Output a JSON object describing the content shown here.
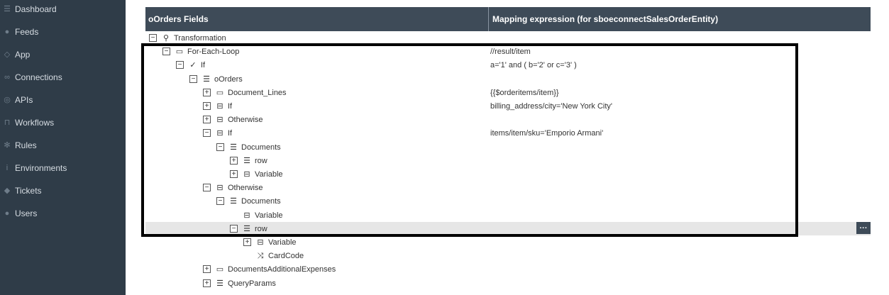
{
  "sidebar": {
    "items": [
      {
        "label": "Dashboard",
        "icon": "database-icon"
      },
      {
        "label": "Feeds",
        "icon": "comments-icon"
      },
      {
        "label": "App",
        "icon": "tag-icon"
      },
      {
        "label": "Connections",
        "icon": "link-icon"
      },
      {
        "label": "APIs",
        "icon": "globe-icon"
      },
      {
        "label": "Workflows",
        "icon": "workflow-icon"
      },
      {
        "label": "Rules",
        "icon": "gear-icon"
      },
      {
        "label": "Environments",
        "icon": "info-icon"
      },
      {
        "label": "Tickets",
        "icon": "ticket-icon"
      },
      {
        "label": "Users",
        "icon": "user-icon"
      }
    ]
  },
  "grid": {
    "header": {
      "fields": "oOrders Fields",
      "mapping": "Mapping expression (for sboeconnectSalesOrderEntity)"
    },
    "rows": [
      {
        "label": "Transformation",
        "expr": "",
        "toggle": "−",
        "icon": "pin-icon"
      },
      {
        "label": "For-Each-Loop",
        "expr": "//result/item",
        "toggle": "−",
        "icon": "loop-icon"
      },
      {
        "label": "If",
        "expr": "a='1' and ( b='2' or c='3' )",
        "toggle": "−",
        "icon": "check-circle-icon"
      },
      {
        "label": "oOrders",
        "expr": "",
        "toggle": "−",
        "icon": "table-icon"
      },
      {
        "label": "Document_Lines",
        "expr": "{{$orderitems/item}}",
        "toggle": "+",
        "icon": "loop-icon"
      },
      {
        "label": "If",
        "expr": "billing_address/city='New York City'",
        "toggle": "+",
        "icon": "drive-icon"
      },
      {
        "label": "Otherwise",
        "expr": "",
        "toggle": "+",
        "icon": "drive-icon"
      },
      {
        "label": "If",
        "expr": "items/item/sku='Emporio Armani'",
        "toggle": "−",
        "icon": "drive-icon"
      },
      {
        "label": "Documents",
        "expr": "",
        "toggle": "−",
        "icon": "table-icon"
      },
      {
        "label": "row",
        "expr": "",
        "toggle": "+",
        "icon": "table-icon"
      },
      {
        "label": "Variable",
        "expr": "",
        "toggle": "+",
        "icon": "drive-icon"
      },
      {
        "label": "Otherwise",
        "expr": "",
        "toggle": "−",
        "icon": "drive-icon"
      },
      {
        "label": "Documents",
        "expr": "",
        "toggle": "−",
        "icon": "table-icon"
      },
      {
        "label": "Variable",
        "expr": "",
        "toggle": "",
        "icon": "drive-icon"
      },
      {
        "label": "row",
        "expr": "",
        "toggle": "−",
        "icon": "table-icon"
      },
      {
        "label": "Variable",
        "expr": "",
        "toggle": "+",
        "icon": "drive-icon"
      },
      {
        "label": "CardCode",
        "expr": "",
        "toggle": "",
        "icon": "shuffle-icon"
      },
      {
        "label": "DocumentsAdditionalExpenses",
        "expr": "",
        "toggle": "+",
        "icon": "loop-icon"
      },
      {
        "label": "QueryParams",
        "expr": "",
        "toggle": "+",
        "icon": "table-icon"
      }
    ]
  },
  "more_button": {
    "label": "···"
  },
  "colors": {
    "sidebar_bg": "#2f3c48",
    "header_bg": "#3e4b58",
    "selected_row_bg": "#e6e6e6"
  }
}
